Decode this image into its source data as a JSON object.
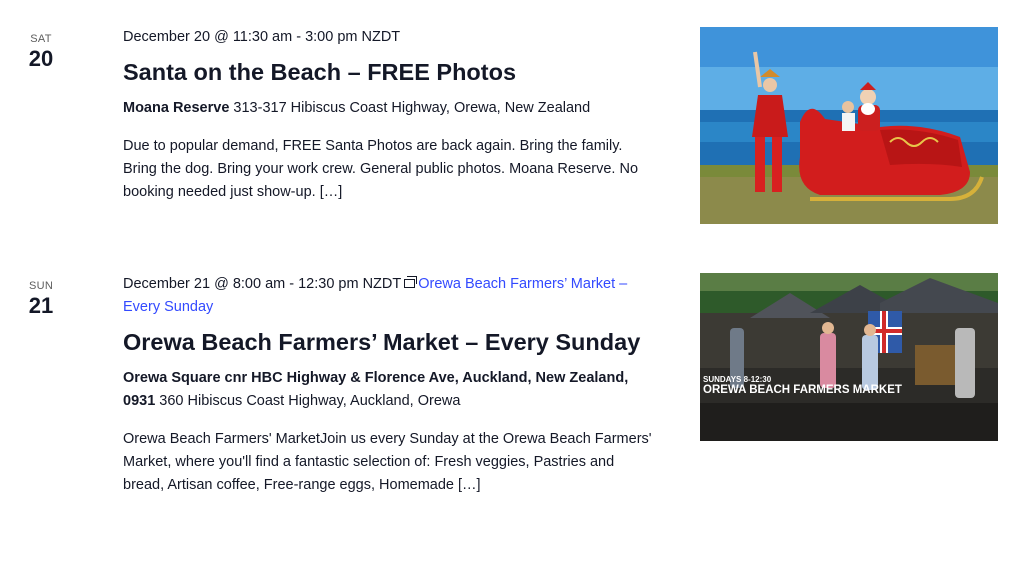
{
  "events": [
    {
      "day_of_week": "SAT",
      "day_number": "20",
      "datetime": "December 20 @ 11:30 am - 3:00 pm NZDT",
      "title": "Santa on the Beach – FREE Photos",
      "venue_name": "Moana Reserve",
      "venue_address": " 313-317 Hibiscus Coast Highway, Orewa, New Zealand",
      "description": "Due to popular demand, FREE Santa Photos are back again. Bring the family. Bring the dog. Bring your work crew. General public photos. Moana Reserve. No booking needed just show-up. […]"
    },
    {
      "day_of_week": "SUN",
      "day_number": "21",
      "datetime": "December 21 @ 8:00 am - 12:30 pm NZDT",
      "series_link": "Orewa Beach Farmers’ Market – Every Sunday",
      "title": "Orewa Beach Farmers’ Market – Every Sunday",
      "venue_name": "Orewa Square cnr HBC Highway & Florence Ave, Auckland, New Zealand, 0931",
      "venue_address": " 360 Hibiscus Coast Highway, Auckland, Orewa",
      "description": "Orewa Beach Farmers' MarketJoin us every Sunday at the Orewa Beach Farmers' Market, where you'll find a fantastic selection of: Fresh veggies, Pastries and bread, Artisan coffee, Free-range eggs, Homemade […]",
      "image_overlay_small": "SUNDAYS 8-12:30",
      "image_overlay_title": "OREWA BEACH FARMERS MARKET"
    }
  ],
  "colors": {
    "link": "#334aff",
    "text": "#141827",
    "muted": "#5d5d5d"
  },
  "icons": {
    "series": "recurring-series-icon"
  }
}
